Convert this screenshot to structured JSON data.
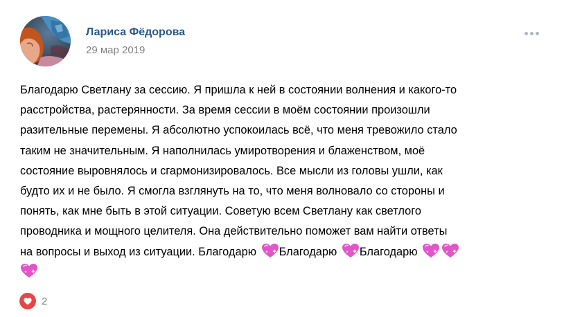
{
  "post": {
    "author": "Лариса Фёдорова",
    "date": "29 мар 2019",
    "text_lines": [
      "Благодарю Светлану за сессию. Я пришла к ней в состоянии волнения и какого-то",
      "расстройства, растерянности. За время сессии в моём состоянии произошли",
      "разительные перемены. Я абсолютно успокоилась всё, что меня тревожило стало",
      "таким не значительным. Я наполнилась умиротворения и блаженством, моё",
      "состояние выровнялось и сгармонизировалось. Все мысли из головы ушли, как",
      "будто их и не было. Я смогла взглянуть на то, что меня волновало со стороны и",
      "понять, как мне быть в этой ситуации. Советую всем Светлану как светлого",
      "проводника и мощного целителя. Она действительно поможет вам найти ответы",
      "на вопросы и выход из ситуации. Благодарю "
    ],
    "thanks_word": "Благодарю ",
    "emoji": "sparkling-heart-icon",
    "likes": "2"
  },
  "colors": {
    "author": "#2a5885",
    "meta": "#828282",
    "like_heart": "#e64646",
    "emoji_heart": "#e055c9"
  }
}
